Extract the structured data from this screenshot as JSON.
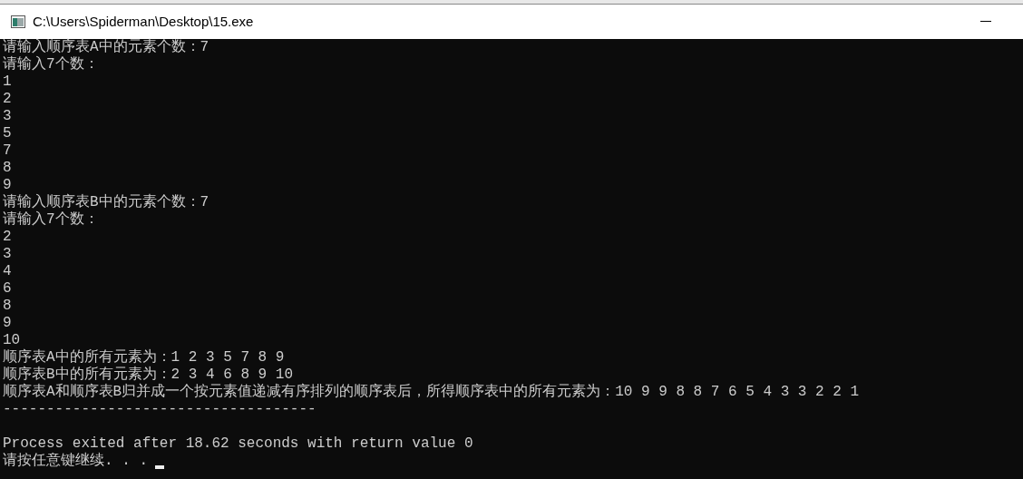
{
  "window": {
    "title": "C:\\Users\\Spiderman\\Desktop\\15.exe"
  },
  "console": {
    "lines": [
      {
        "kind": "text",
        "text": "请输入顺序表A中的元素个数：7"
      },
      {
        "kind": "text",
        "text": "请输入7个数："
      },
      {
        "kind": "text",
        "text": "1"
      },
      {
        "kind": "text",
        "text": "2"
      },
      {
        "kind": "text",
        "text": "3"
      },
      {
        "kind": "text",
        "text": "5"
      },
      {
        "kind": "text",
        "text": "7"
      },
      {
        "kind": "text",
        "text": "8"
      },
      {
        "kind": "text",
        "text": "9"
      },
      {
        "kind": "text",
        "text": "请输入顺序表B中的元素个数：7"
      },
      {
        "kind": "text",
        "text": "请输入7个数："
      },
      {
        "kind": "text",
        "text": "2"
      },
      {
        "kind": "text",
        "text": "3"
      },
      {
        "kind": "text",
        "text": "4"
      },
      {
        "kind": "text",
        "text": "6"
      },
      {
        "kind": "text",
        "text": "8"
      },
      {
        "kind": "text",
        "text": "9"
      },
      {
        "kind": "text",
        "text": "10"
      },
      {
        "kind": "text",
        "text": "顺序表A中的所有元素为：1 2 3 5 7 8 9"
      },
      {
        "kind": "text",
        "text": "顺序表B中的所有元素为：2 3 4 6 8 9 10"
      },
      {
        "kind": "text",
        "text": "顺序表A和顺序表B归并成一个按元素值递减有序排列的顺序表后，所得顺序表中的所有元素为：10 9 9 8 8 7 6 5 4 3 3 2 2 1"
      },
      {
        "kind": "text",
        "text": "------------------------------------"
      },
      {
        "kind": "blank"
      },
      {
        "kind": "text",
        "text": "Process exited after 18.62 seconds with return value 0"
      },
      {
        "kind": "text",
        "text": "请按任意键继续. . ."
      }
    ],
    "cursor_visible": true
  }
}
